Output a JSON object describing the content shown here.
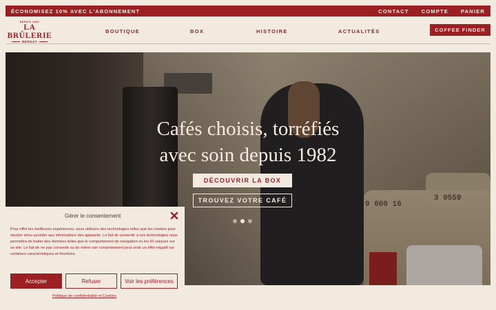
{
  "topbar": {
    "promo": "ÉCONOMISEZ 10% AVEC L'ABONNEMENT",
    "links": [
      "CONTACT",
      "COMPTE",
      "PANIER"
    ]
  },
  "logo": {
    "since": "DEPUIS 1982",
    "brand": "LA BRÛLERIE",
    "city": "BERNAY"
  },
  "nav": [
    "BOUTIQUE",
    "BOX",
    "HISTOIRE",
    "ACTUALITÉS"
  ],
  "coffee_finder": "COFFEE FINDER",
  "hero": {
    "headline": "Cafés choisis, torréfiés avec soin depuis 1982",
    "cta_primary": "DÉCOUVRIR LA BOX",
    "cta_secondary": "TROUVEZ VOTRE CAFÉ",
    "slide_count": 3,
    "active_slide": 2,
    "sack_labels": [
      "9 000 16",
      "3 0559"
    ]
  },
  "consent": {
    "title": "Gérer le consentement",
    "text": "Pour offrir les meilleures expériences, nous utilisons des technologies telles que les cookies pour stocker et/ou accéder aux informations des appareils. Le fait de consentir à ces technologies nous permettra de traiter des données telles que le comportement de navigation ou les ID uniques sur ce site. Le fait de ne pas consentir ou de retirer son consentement peut avoir un effet négatif sur certaines caractéristiques et fonctions.",
    "accept": "Accepter",
    "refuse": "Refuser",
    "preferences": "Voir les préférences",
    "policy": "Politique de confidentialité et Cookies"
  },
  "colors": {
    "brand_red": "#9c1f24",
    "cream": "#f2e9df"
  }
}
